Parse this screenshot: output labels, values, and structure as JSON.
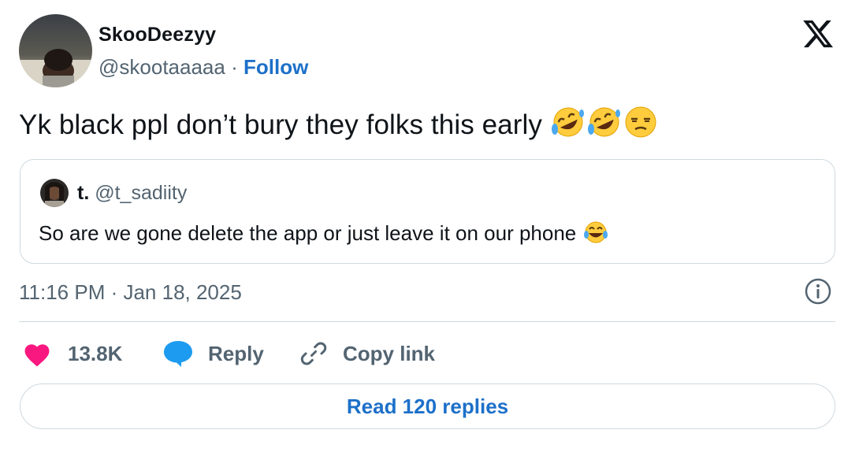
{
  "author": {
    "display_name": "SkooDeezyy",
    "handle": "@skootaaaaa",
    "separator": "·",
    "follow_label": "Follow"
  },
  "tweet": {
    "text": "Yk black ppl don’t bury they folks this early",
    "emojis": [
      "rolling-on-floor-laughing",
      "rolling-on-floor-laughing",
      "unamused-face"
    ]
  },
  "quoted_tweet": {
    "display_name": "t.",
    "handle": "@t_sadiity",
    "text": "So are we gone delete the app or just leave it on our phone",
    "emoji": "face-with-tears-of-joy"
  },
  "timestamp": "11:16 PM · Jan 18, 2025",
  "actions": {
    "like_count": "13.8K",
    "reply_label": "Reply",
    "copy_link_label": "Copy link"
  },
  "read_replies_label": "Read 120 replies",
  "icons": {
    "brand": "x-logo-icon",
    "info": "info-icon",
    "like": "heart-icon",
    "reply": "speech-bubble-icon",
    "copy": "link-icon"
  },
  "colors": {
    "link_blue": "#1d70c9",
    "like_pink": "#f91880",
    "reply_blue": "#1d9bf0",
    "muted_text": "#536471",
    "border": "#cfd9de"
  }
}
